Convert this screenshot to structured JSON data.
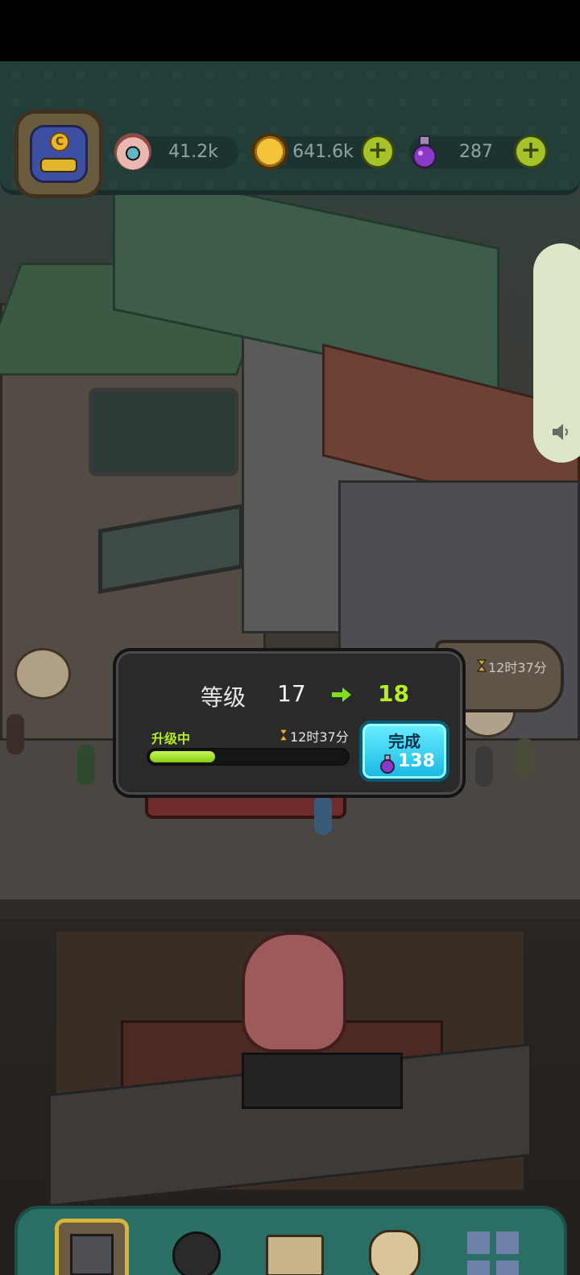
{
  "hud": {
    "eyeballs": "41.2k",
    "coins": "641.6k",
    "potions": "287",
    "side_timer": "12时37分"
  },
  "upgrade_popup": {
    "level_label": "等级",
    "level_from": "17",
    "level_to": "18",
    "status_label": "升级中",
    "timer": "12时37分",
    "progress": 0.33,
    "complete_label": "完成",
    "complete_cost": "138"
  },
  "colors": {
    "accent_green": "#b6ee25",
    "button_cyan": "#18b7e4",
    "hud_teal": "#233d39"
  },
  "nav": {
    "items": [
      "building-icon",
      "monster-icon",
      "book-icon",
      "money-bag-icon",
      "grid-menu-icon"
    ]
  }
}
